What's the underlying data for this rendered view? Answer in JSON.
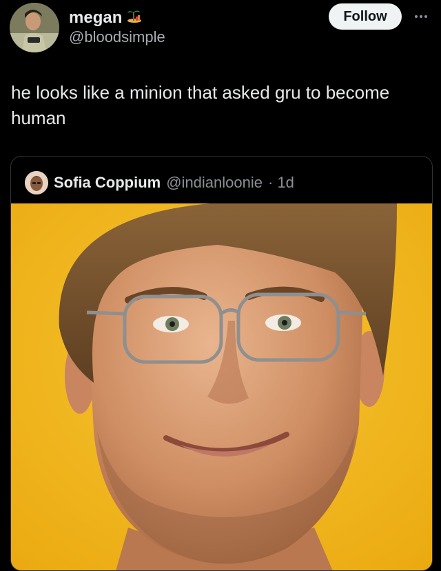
{
  "post": {
    "author": {
      "display_name": "megan",
      "handle": "@bloodsimple",
      "name_emoji": "desert-island-emoji",
      "avatar": "profile-photo"
    },
    "follow_label": "Follow",
    "more_icon": "more-options-icon",
    "text": "he looks like a minion that asked gru to become human"
  },
  "quoted_post": {
    "author": {
      "display_name": "Sofia Coppium",
      "handle": "@indianloonie",
      "time": "· 1d",
      "avatar": "profile-photo"
    },
    "image": "portrait-photo-man-with-glasses-on-yellow-background"
  },
  "colors": {
    "background": "#000000",
    "text_primary": "#e7e9ea",
    "text_secondary": "#8b9096",
    "follow_bg": "#eff3f4",
    "image_bg": "#f1b71b"
  }
}
